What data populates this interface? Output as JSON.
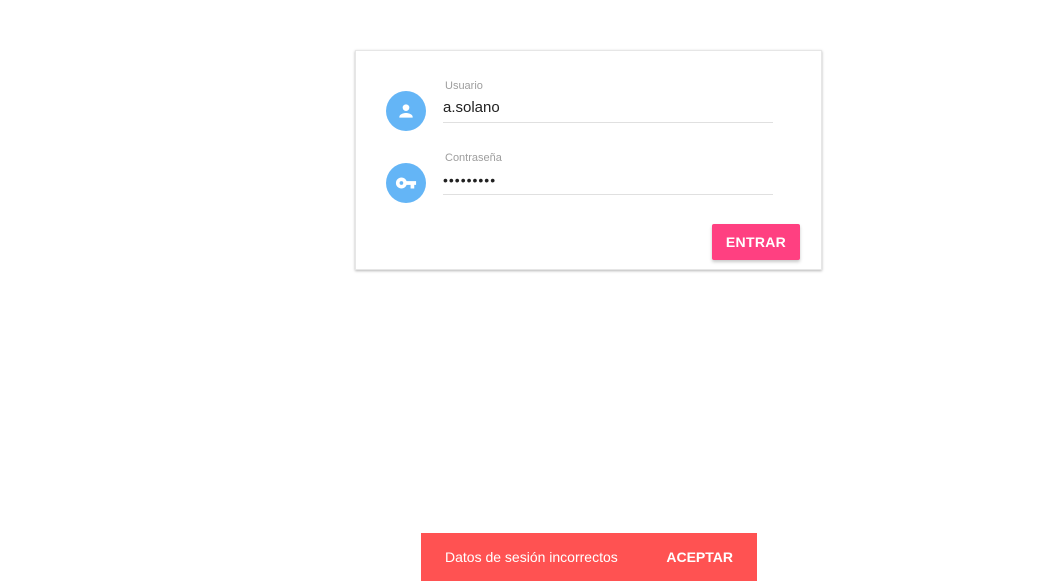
{
  "login": {
    "user_icon": "account-circle-icon",
    "user_label": "Usuario",
    "user_value": "a.solano",
    "password_icon": "vpn-key-icon",
    "password_label": "Contraseña",
    "password_value": "passwordx",
    "enter_label": "ENTRAR"
  },
  "snackbar": {
    "message": "Datos de sesión incorrectos",
    "action_label": "ACEPTAR"
  },
  "colors": {
    "icon_bg": "#64b5f6",
    "accent": "#ff4081",
    "snackbar_bg": "#ff5252"
  }
}
